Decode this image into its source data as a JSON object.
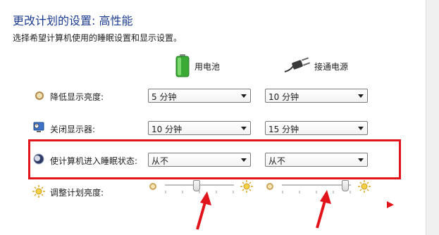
{
  "header": {
    "title": "更改计划的设置: 高性能",
    "description": "选择希望计算机使用的睡眠设置和显示设置。"
  },
  "columns": {
    "battery": {
      "label": "用电池",
      "icon": "battery-icon"
    },
    "plugged": {
      "label": "接通电源",
      "icon": "power-plug-icon"
    }
  },
  "rows": [
    {
      "label": "降低显示亮度:",
      "icon": "dim-brightness-icon",
      "battery": "5 分钟",
      "plugged": "10 分钟"
    },
    {
      "label": "关闭显示器:",
      "icon": "monitor-off-icon",
      "battery": "10 分钟",
      "plugged": "15 分钟"
    },
    {
      "label": "使计算机进入睡眠状态:",
      "icon": "sleep-icon",
      "battery": "从不",
      "plugged": "从不"
    }
  ],
  "brightness": {
    "label": "调整计划亮度:",
    "battery_level": 0.45,
    "plugged_level": 0.97
  },
  "colors": {
    "title": "#1c3b8c",
    "highlight_border": "#e0141a",
    "annotation_arrow": "#e0141a"
  }
}
